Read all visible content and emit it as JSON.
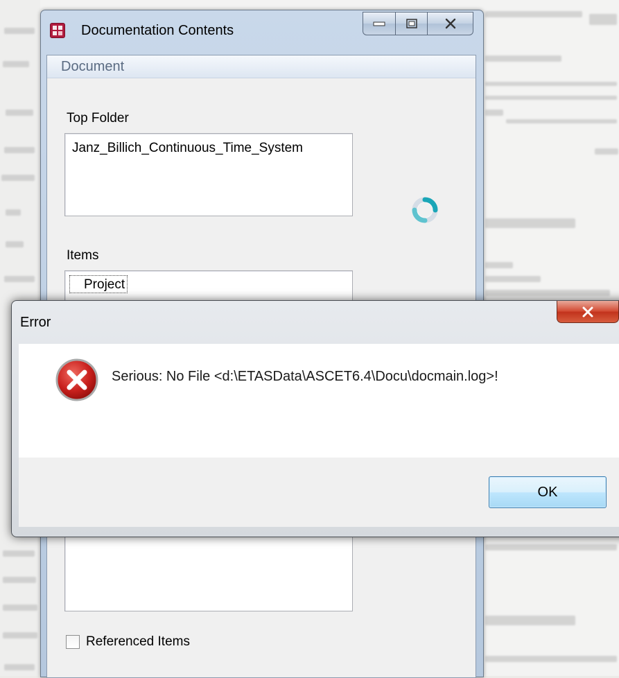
{
  "doc_window": {
    "title": "Documentation Contents",
    "group_label": "Document",
    "top_folder_label": "Top Folder",
    "top_folder_value": "Janz_Billich_Continuous_Time_System",
    "items_label": "Items",
    "items_selected": "Project",
    "referenced_items_label": "Referenced Items",
    "referenced_items_checked": false
  },
  "error_dialog": {
    "title": "Error",
    "message": "Serious: No File <d:\\ETASData\\ASCET6.4\\Docu\\docmain.log>!",
    "ok_label": "OK"
  },
  "icons": {
    "app": "documentation-app-icon",
    "minimize": "minimize-icon",
    "maximize": "maximize-icon",
    "close": "close-icon",
    "busy": "busy-spinner-icon",
    "error": "error-icon"
  },
  "colors": {
    "error_icon": "#c8201d",
    "close_button": "#c1321c",
    "ok_button_border": "#3c7fb1",
    "spinner": "#1aa6b7"
  }
}
